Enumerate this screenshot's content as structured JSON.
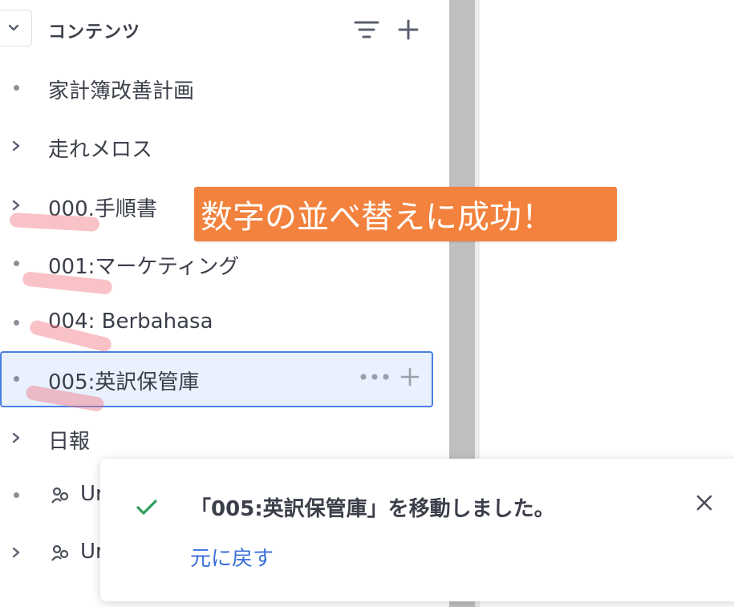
{
  "sidebar": {
    "header": {
      "title": "コンテンツ",
      "collapse_icon": "chevron-down-icon",
      "filter_icon": "filter-icon",
      "add_icon": "plus-icon"
    },
    "items": [
      {
        "label": "家計簿改善計画",
        "marker": "bullet"
      },
      {
        "label": "走れメロス",
        "marker": "chevron-right"
      },
      {
        "label": "000.手順書",
        "marker": "chevron-right"
      },
      {
        "label": "001:マーケティング",
        "marker": "bullet"
      },
      {
        "label": "004: Berbahasa",
        "marker": "bullet"
      },
      {
        "label": "005:英訳保管庫",
        "marker": "bullet",
        "selected": true
      },
      {
        "label": "日報",
        "marker": "chevron-right"
      },
      {
        "label": "Ur",
        "marker": "bullet",
        "icon": "people-icon"
      },
      {
        "label": "Ur",
        "marker": "chevron-right",
        "icon": "people-icon"
      }
    ]
  },
  "callout": {
    "text": "数字の並べ替えに成功！"
  },
  "toast": {
    "message": "「005:英訳保管庫」を移動しました。",
    "undo_label": "元に戻す",
    "check_icon": "check-icon",
    "close_icon": "close-icon"
  },
  "colors": {
    "accent": "#4a7fe0",
    "selected_bg": "#e8f1fd",
    "callout": "#f2823d",
    "link": "#3b6fd8",
    "success": "#2e9e5b"
  }
}
